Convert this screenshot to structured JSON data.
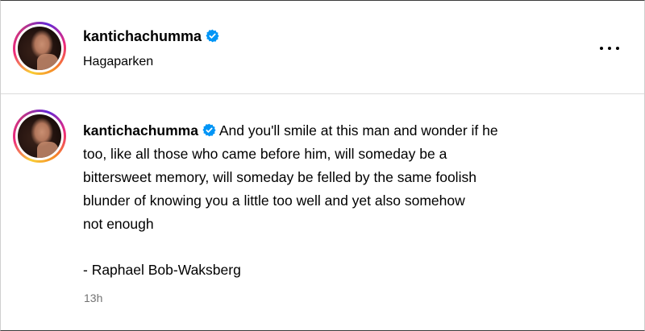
{
  "post": {
    "author": "kantichachumma",
    "location": "Hagaparken",
    "verified": true,
    "more_icon": "more-horizontal-icon"
  },
  "caption": {
    "username": "kantichachumma",
    "lines": [
      "And you'll smile at this man and wonder if he",
      "too, like all those who came before him, will someday be a",
      "bittersweet memory, will someday be felled by the same foolish",
      "blunder of knowing you a little too well and yet also somehow",
      "not enough"
    ],
    "attribution": "- Raphael Bob-Waksberg",
    "timestamp": "13h"
  },
  "colors": {
    "verified_badge": "#0095f6",
    "muted_text": "#737373",
    "divider": "#dbdbdb"
  }
}
